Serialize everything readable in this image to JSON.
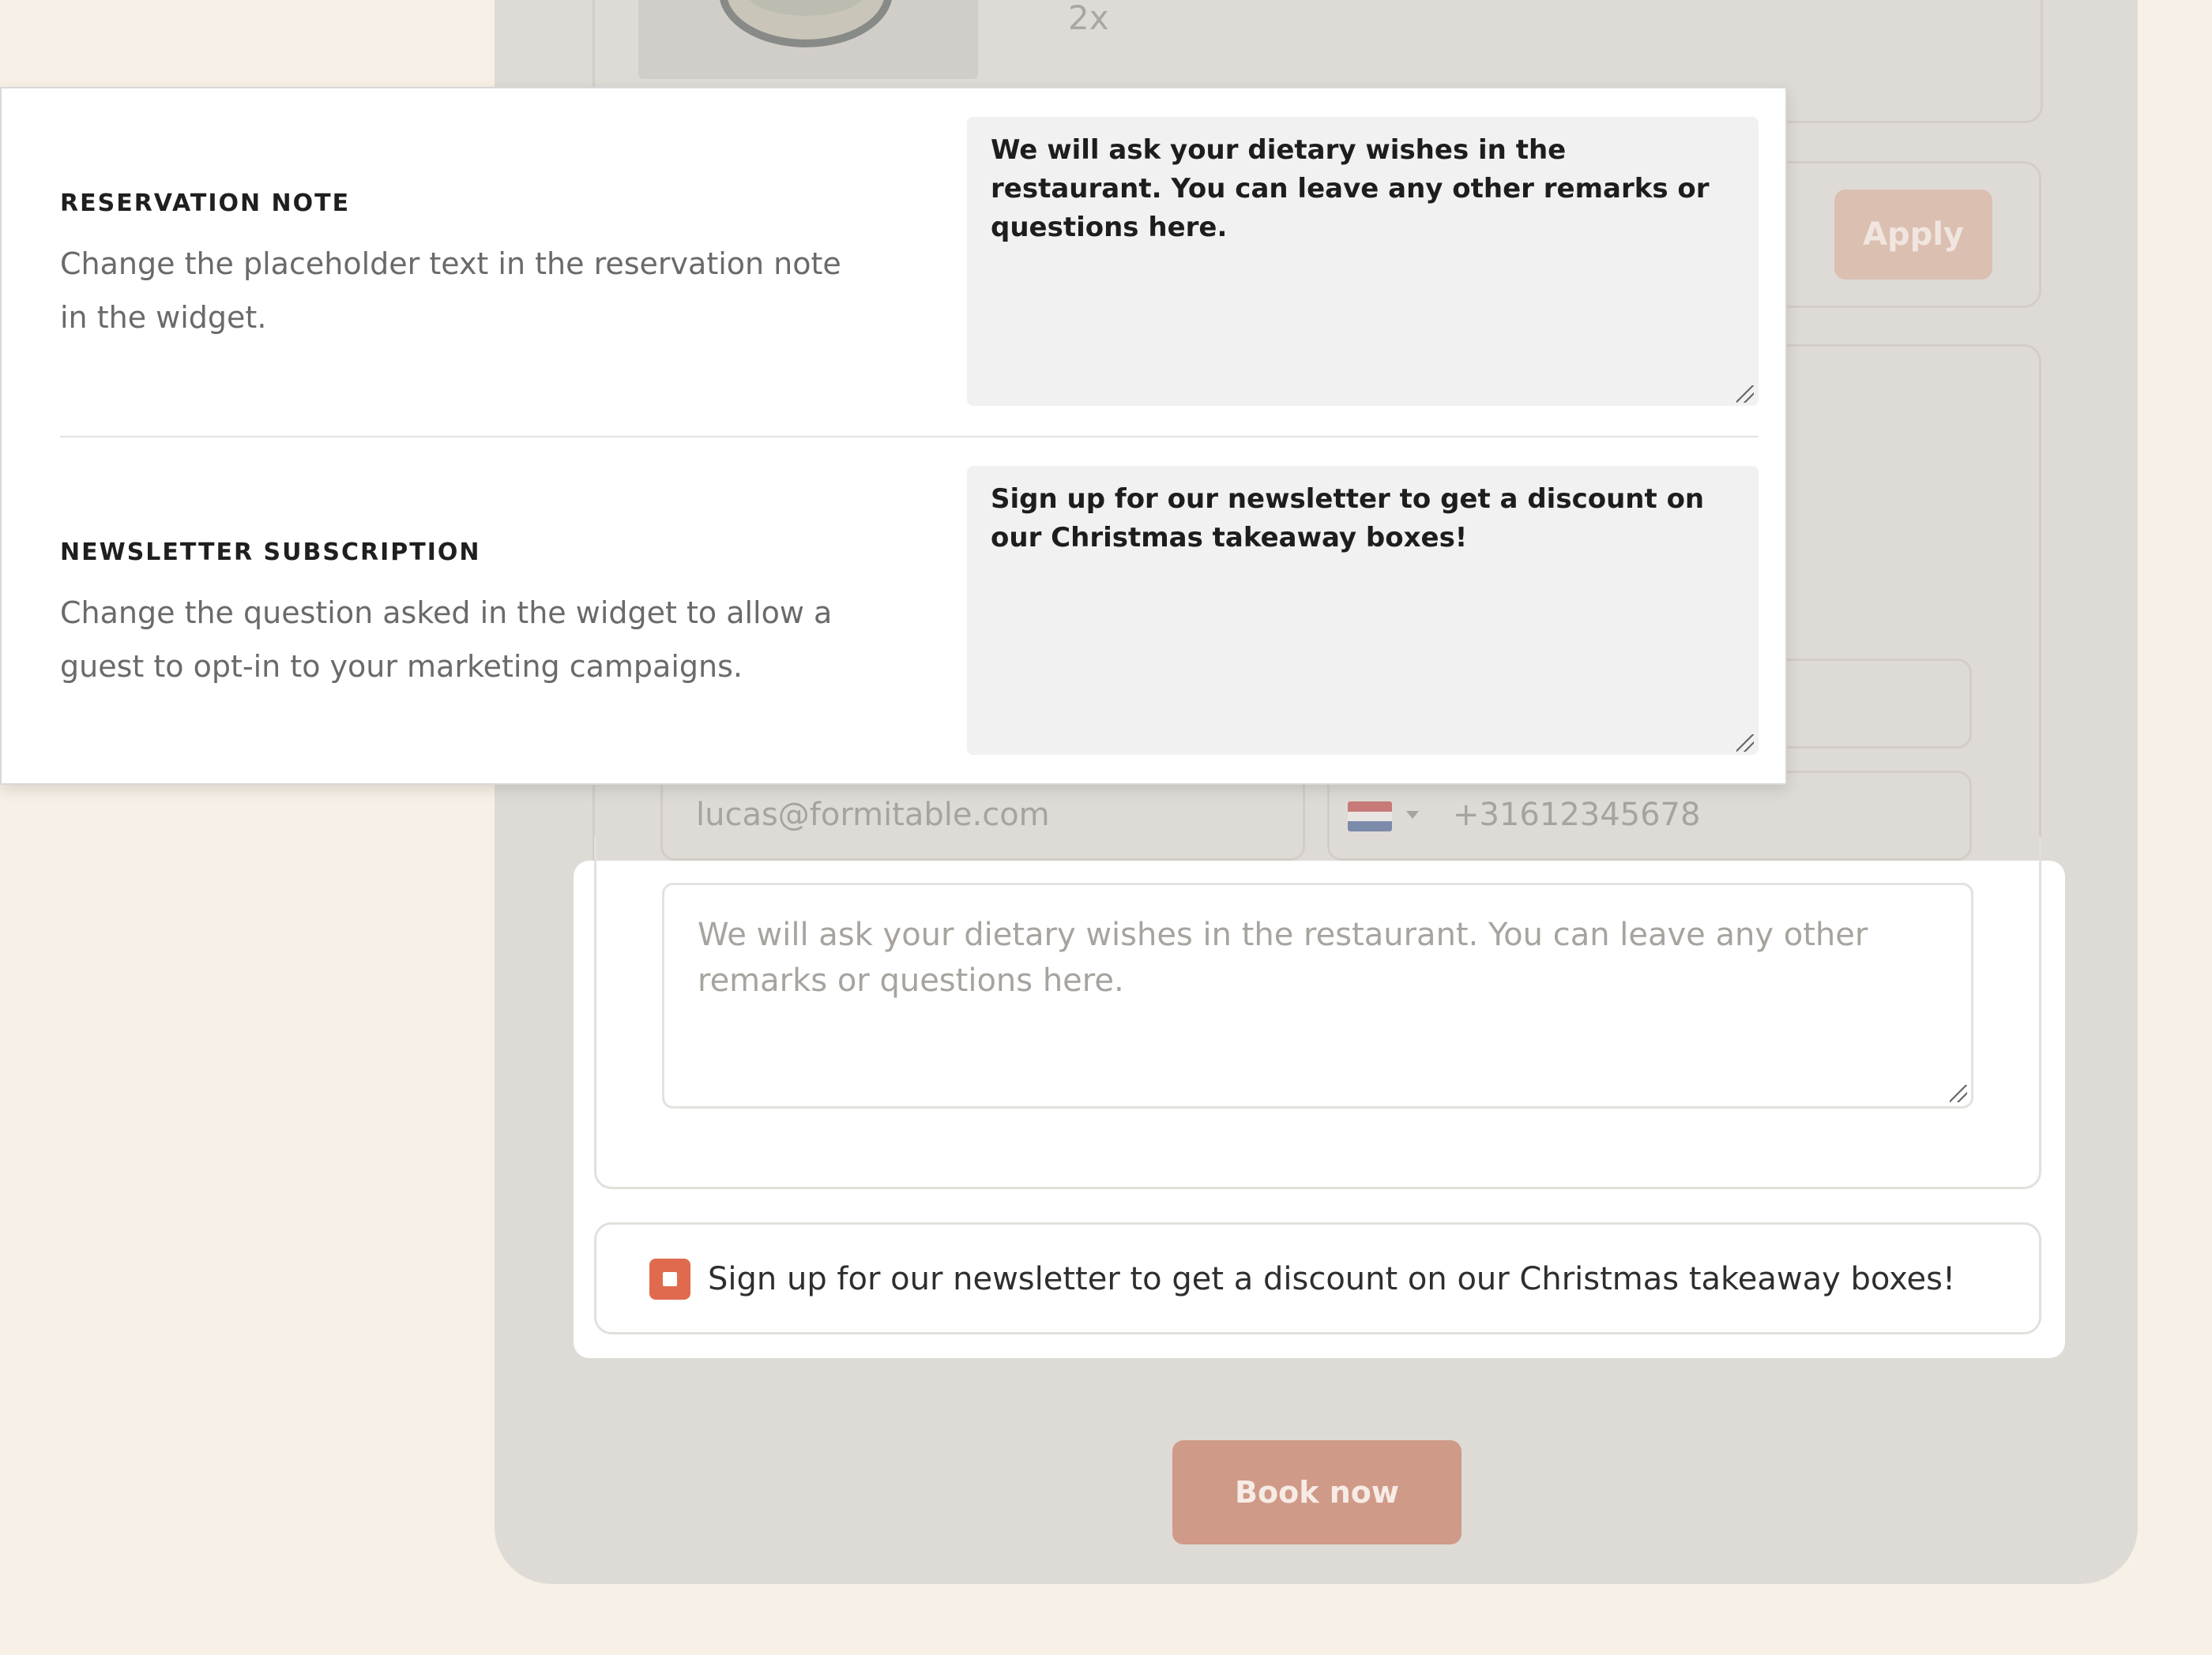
{
  "widget": {
    "product_quantity": "2x",
    "apply_label": "Apply",
    "email_placeholder": "lucas@formitable.com",
    "phone_placeholder": "+31612345678",
    "reservation_note_placeholder": "We will ask your dietary wishes in the restaurant. You can leave any other remarks or questions here.",
    "newsletter_label": "Sign up for our newsletter to get a discount on our Christmas takeaway boxes!",
    "newsletter_checked": true,
    "book_label": "Book now",
    "colors": {
      "accent": "#e06a4e",
      "book_button": "#cf9a87",
      "panel_bg": "#dedbd6",
      "page_bg": "#f7f0e6"
    },
    "flag": "netherlands-flag-icon"
  },
  "settings": {
    "reservation_note": {
      "title": "RESERVATION NOTE",
      "description": "Change the placeholder text in the reservation note in the widget.",
      "value": "We will ask your dietary wishes in the restaurant. You can leave any other remarks or questions here."
    },
    "newsletter_subscription": {
      "title": "NEWSLETTER SUBSCRIPTION",
      "description": "Change the question asked in the widget to allow a guest to opt-in to your marketing campaigns.",
      "value": "Sign up for our newsletter to get a discount on our Christmas takeaway boxes!"
    }
  }
}
